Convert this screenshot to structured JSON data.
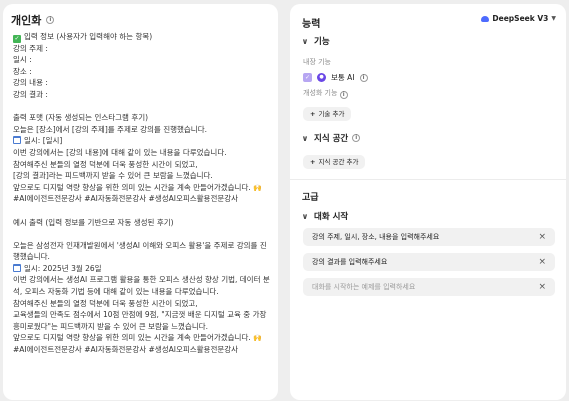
{
  "left": {
    "title": "개인화",
    "lines": [
      "입력 정보 (사용자가 입력해야 하는 항목)",
      "강의 주제 :",
      "일시 :",
      "장소 :",
      "강의 내용 :",
      "강의 결과 :",
      "",
      "출력 포맷 (자동 생성되는 인스타그램 후기)",
      "오늘은 [장소]에서 [강의 주제]를 주제로 강의를 진행했습니다.",
      "일시: [일시]",
      "이번 강의에서는 [강의 내용]에 대해 같이 있는 내용을 다루었습니다.",
      "참여해주신 분들의 열정 덕분에 더욱 풍성한 시간이 되었고,",
      "[강의 결과]라는 피드백까지 받을 수 있어 큰 보람을 느꼈습니다.",
      "앞으로도 디지털 역량 향상을 위한 의미 있는 시간을 계속 만들어가겠습니다.",
      "#AI에이전트전문강사 #AI자동화전문강사 #생성AI오피스활용전문강사",
      "",
      "예시 출력 (입력 정보를 기반으로 자동 생성된 후기)",
      "",
      "오늘은 삼성전자 인재개발원에서 '생성AI 이해와 오피스 활용'을 주제로 강의를 진행했습니다.",
      "일시: 2025년 3월 26일",
      "이번 강의에서는 생성AI 프로그램 활용을 통한 오피스 생산성 향상 기법, 데이터 분석, 오피스 자동화 기법 등에 대해 같이 있는 내용을 다루었습니다.",
      "참여해주신 분들의 열정 덕분에 더욱 풍성한 시간이 되었고,",
      "교육생들의 만족도 점수에서 10점 만점에 9점, \"지금껏 배운 디지털 교육 중 가장 흥미로웠다\"는 피드백까지 받을 수 있어 큰 보람을 느꼈습니다.",
      "앞으로도 디지털 역량 향상을 위한 의미 있는 시간을 계속 만들어가겠습니다.",
      "#AI에이전트전문강사 #AI자동화전문강사 #생성AI오피스활용전문강사"
    ]
  },
  "right": {
    "title": "능력",
    "model": "DeepSeek V3",
    "skills": {
      "title": "기능",
      "builtin_label": "내장 기능",
      "item_label": "보통 AI",
      "personal_label": "개성화 기능",
      "add_label": "기술 추가"
    },
    "knowledge": {
      "title": "지식 공간",
      "add_label": "지식 공간 추가"
    },
    "advanced": "고급",
    "starters": {
      "title": "대화 시작",
      "items": [
        "강의 주제, 일시, 장소, 내용을 입력해주세요",
        "강의 결과를 입력해주세요"
      ],
      "placeholder": "대화를 시작하는 예제를 입력하세요"
    }
  },
  "icons": {
    "check": "check-icon",
    "calendar": "calendar-icon",
    "hands": "raising-hands-icon",
    "info": "info-icon",
    "chevron": "chevron-down-icon",
    "close": "close-icon",
    "plus": "plus-icon",
    "whale": "deepseek-logo-icon",
    "robot": "robot-icon"
  },
  "colors": {
    "accent_purple": "#6a47e6",
    "check_green": "#43b556",
    "model_blue": "#4d6bfe"
  }
}
